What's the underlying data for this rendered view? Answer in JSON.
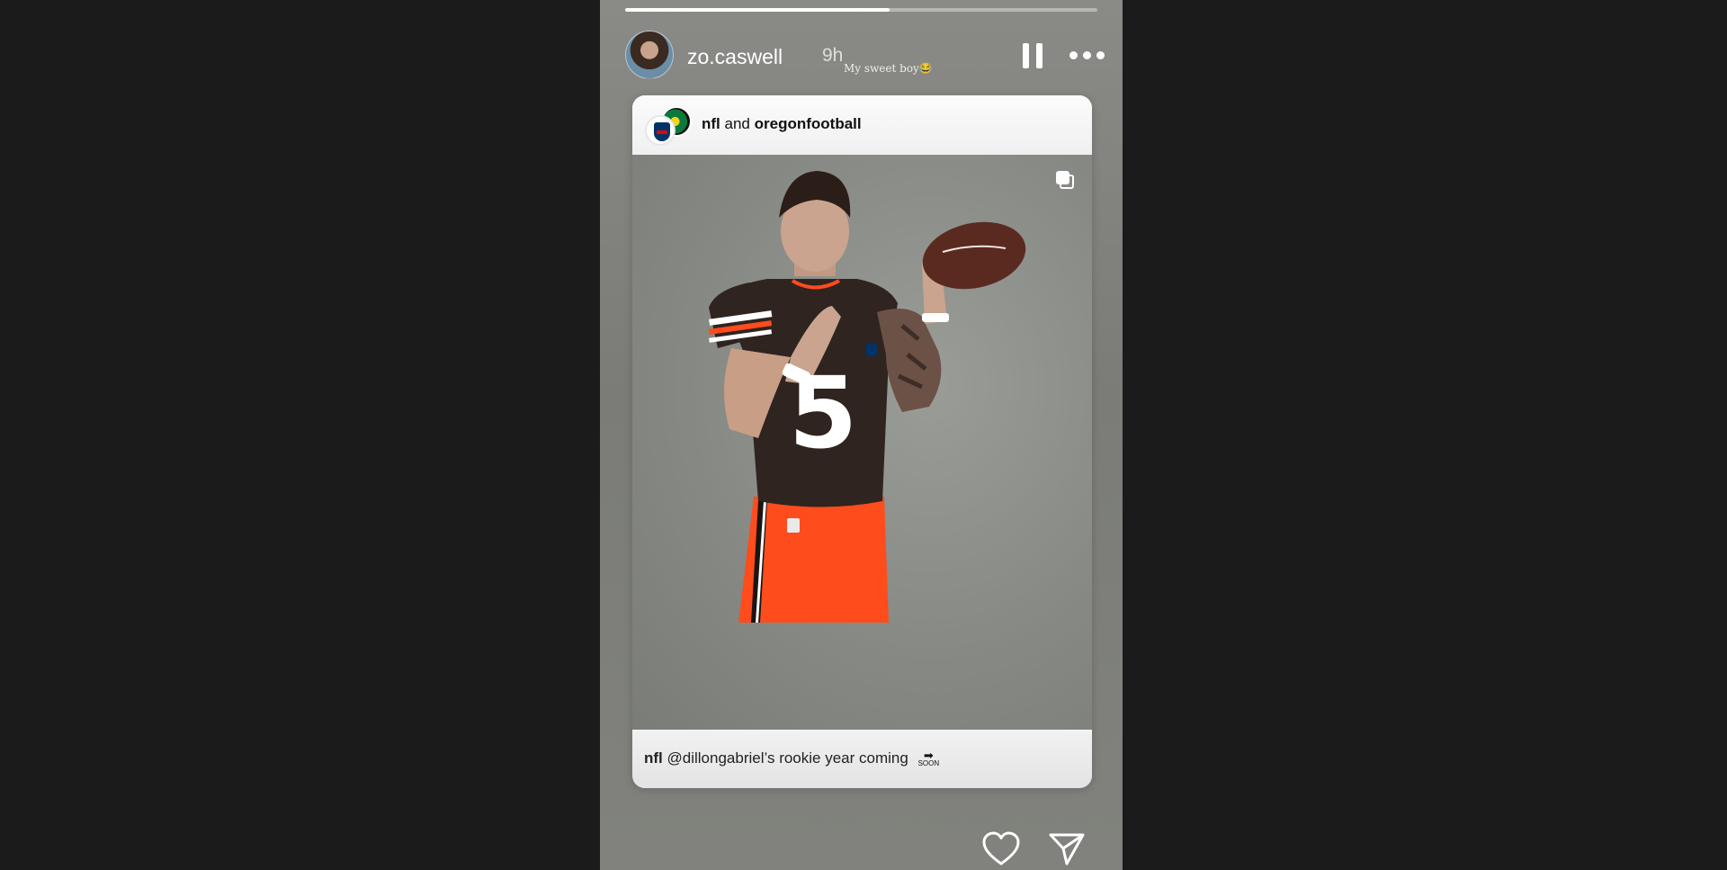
{
  "story": {
    "progress": 0.56,
    "author": {
      "username": "zo.caswell",
      "time": "9h",
      "caption": "My sweet boy😂"
    },
    "controls": {
      "pause_icon": "pause-icon",
      "more_icon": "more-options-icon"
    }
  },
  "shared_post": {
    "collab_user_1": "nfl",
    "collab_join": "and",
    "collab_user_2": "oregonfootball",
    "player_number": "5",
    "footer_user": "nfl",
    "footer_text": "@dillongabriel’s rookie year coming",
    "soon_label": "SOON",
    "soon_arrow": "➡"
  },
  "actions": {
    "like_icon": "heart-icon",
    "share_icon": "send-icon"
  },
  "colors": {
    "background": "#1b1b1b",
    "jersey_brown": "#2f241f",
    "jersey_orange": "#ff4c1c",
    "nfl_blue": "#013369",
    "nfl_red": "#d50a0a"
  }
}
